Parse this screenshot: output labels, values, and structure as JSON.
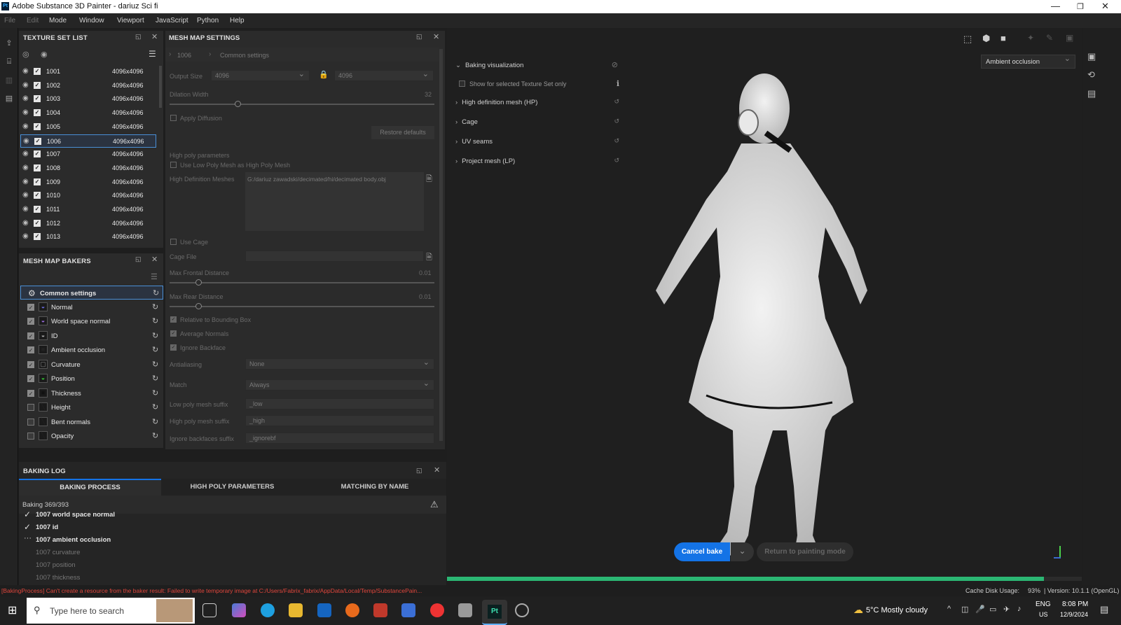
{
  "app": {
    "title": "Adobe Substance 3D Painter - dariuz Sci fi",
    "logo": "Pt"
  },
  "menu": [
    "File",
    "Edit",
    "Mode",
    "Window",
    "Viewport",
    "JavaScript",
    "Python",
    "Help"
  ],
  "texture_set_list": {
    "title": "TEXTURE SET LIST",
    "items": [
      {
        "name": "1001",
        "size": "4096x4096"
      },
      {
        "name": "1002",
        "size": "4096x4096"
      },
      {
        "name": "1003",
        "size": "4096x4096"
      },
      {
        "name": "1004",
        "size": "4096x4096"
      },
      {
        "name": "1005",
        "size": "4096x4096"
      },
      {
        "name": "1006",
        "size": "4096x4096",
        "selected": true
      },
      {
        "name": "1007",
        "size": "4096x4096"
      },
      {
        "name": "1008",
        "size": "4096x4096"
      },
      {
        "name": "1009",
        "size": "4096x4096"
      },
      {
        "name": "1010",
        "size": "4096x4096"
      },
      {
        "name": "1011",
        "size": "4096x4096"
      },
      {
        "name": "1012",
        "size": "4096x4096"
      },
      {
        "name": "1013",
        "size": "4096x4096"
      }
    ]
  },
  "mesh_map_bakers": {
    "title": "MESH MAP BAKERS",
    "items": [
      {
        "label": "Common settings",
        "checked": null,
        "icon": "gear-icon"
      },
      {
        "label": "Normal",
        "checked": true
      },
      {
        "label": "World space normal",
        "checked": true
      },
      {
        "label": "ID",
        "checked": true
      },
      {
        "label": "Ambient occlusion",
        "checked": true
      },
      {
        "label": "Curvature",
        "checked": true
      },
      {
        "label": "Position",
        "checked": true
      },
      {
        "label": "Thickness",
        "checked": true
      },
      {
        "label": "Height",
        "checked": false
      },
      {
        "label": "Bent normals",
        "checked": false
      },
      {
        "label": "Opacity",
        "checked": false
      }
    ]
  },
  "mesh_map_settings": {
    "title": "MESH MAP SETTINGS",
    "breadcrumb": [
      "1006",
      "Common settings"
    ],
    "output_size_label": "Output Size",
    "output_size_a": "4096",
    "output_size_b": "4096",
    "dilation_label": "Dilation Width",
    "dilation_value": "32",
    "apply_diffusion": "Apply Diffusion",
    "restore_defaults": "Restore defaults",
    "high_poly_params": "High poly parameters",
    "use_low_poly": "Use Low Poly Mesh as High Poly Mesh",
    "hd_meshes_label": "High Definition Meshes",
    "hd_meshes_value": "G:/dariuz zawadski/decimated/hi/decimated body.obj",
    "use_cage": "Use Cage",
    "cage_file": "Cage File",
    "max_frontal_label": "Max Frontal Distance",
    "max_frontal_value": "0.01",
    "max_rear_label": "Max Rear Distance",
    "max_rear_value": "0.01",
    "relative_bbox": "Relative to Bounding Box",
    "average_normals": "Average Normals",
    "ignore_backface": "Ignore Backface",
    "antialiasing_label": "Antialiasing",
    "antialiasing_value": "None",
    "match_label": "Match",
    "match_value": "Always",
    "low_suffix_label": "Low poly mesh suffix",
    "low_suffix_value": "_low",
    "high_suffix_label": "High poly mesh suffix",
    "high_suffix_value": "_high",
    "ignore_suffix_label": "Ignore backfaces suffix",
    "ignore_suffix_value": "_ignorebf"
  },
  "baking_log": {
    "title": "BAKING LOG",
    "tabs": [
      "BAKING PROCESS",
      "HIGH POLY PARAMETERS",
      "MATCHING BY NAME"
    ],
    "progress": "Baking 369/393",
    "entries": [
      {
        "text": "1007 world space normal",
        "state": "done"
      },
      {
        "text": "1007 id",
        "state": "done"
      },
      {
        "text": "1007 ambient occlusion",
        "state": "running"
      },
      {
        "text": "1007 curvature",
        "state": "pending"
      },
      {
        "text": "1007 position",
        "state": "pending"
      },
      {
        "text": "1007 thickness",
        "state": "pending"
      }
    ]
  },
  "viewport": {
    "sections": [
      "Baking visualization",
      "High definition mesh (HP)",
      "Cage",
      "UV seams",
      "Project mesh (LP)"
    ],
    "show_selected": "Show for selected Texture Set only",
    "display_mode": "Ambient occlusion",
    "cancel_bake": "Cancel bake",
    "return_painting": "Return to painting mode",
    "bake_progress": 0.94
  },
  "status": {
    "error": "[BakingProcess] Can't create a resource from the baker result: Failed to write temporary image at C:/Users/Fabrix_fabrix/AppData/Local/Temp/SubstancePain...",
    "cache": "Cache Disk Usage:",
    "cache_value": "93%",
    "version": "| Version: 10.1.1 (OpenGL)"
  },
  "taskbar": {
    "search_placeholder": "Type here to search",
    "weather": "5°C  Mostly cloudy",
    "lang": "ENG",
    "lang2": "US",
    "time": "8:08 PM",
    "date": "12/9/2024"
  },
  "colors": {
    "accent": "#1473e6",
    "error": "#e0463c",
    "progress": "#2bb673"
  }
}
